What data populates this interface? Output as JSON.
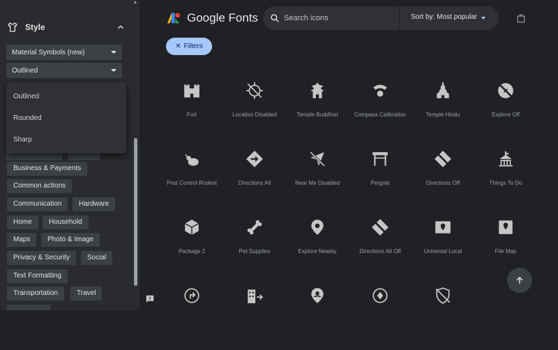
{
  "sidebar": {
    "style_label": "Style",
    "family_select": "Material Symbols (new)",
    "variant_select": "Outlined",
    "variant_options": [
      "Outlined",
      "Rounded",
      "Sharp"
    ],
    "categories": [
      "Business & Payments",
      "Common actions",
      "Communication",
      "Hardware",
      "Home",
      "Household",
      "Maps",
      "Photo & Image",
      "Privacy & Security",
      "Social",
      "Text Formatting",
      "Transportation",
      "Travel"
    ]
  },
  "header": {
    "logo_text": "Google Fonts",
    "search_placeholder": "Search icons",
    "sort_label": "Sort by: Most popular"
  },
  "filters_button": "Filters",
  "icons": [
    {
      "name": "Fort",
      "icon": "fort-icon"
    },
    {
      "name": "Location Disabled",
      "icon": "location-disabled-icon"
    },
    {
      "name": "Temple Buddhist",
      "icon": "temple-buddhist-icon"
    },
    {
      "name": "Compass Calibration",
      "icon": "compass-calibration-icon"
    },
    {
      "name": "Temple Hindu",
      "icon": "temple-hindu-icon"
    },
    {
      "name": "Explore Off",
      "icon": "explore-off-icon"
    },
    {
      "name": "Pest Control Rodent",
      "icon": "pest-control-rodent-icon"
    },
    {
      "name": "Directions Alt",
      "icon": "directions-alt-icon"
    },
    {
      "name": "Near Me Disabled",
      "icon": "near-me-disabled-icon"
    },
    {
      "name": "Pergola",
      "icon": "pergola-icon"
    },
    {
      "name": "Directions Off",
      "icon": "directions-off-icon"
    },
    {
      "name": "Things To Do",
      "icon": "things-to-do-icon"
    },
    {
      "name": "Package 2",
      "icon": "package-2-icon"
    },
    {
      "name": "Pet Supplies",
      "icon": "pet-supplies-icon"
    },
    {
      "name": "Explore Nearby",
      "icon": "explore-nearby-icon"
    },
    {
      "name": "Directions Alt Off",
      "icon": "directions-alt-off-icon"
    },
    {
      "name": "Universal Local",
      "icon": "universal-local-icon"
    },
    {
      "name": "File Map",
      "icon": "file-map-icon"
    },
    {
      "name": "",
      "icon": "turn-arrow-icon"
    },
    {
      "name": "",
      "icon": "domain-arrow-icon"
    },
    {
      "name": "",
      "icon": "person-pin-icon"
    },
    {
      "name": "",
      "icon": "location-arrow-icon"
    },
    {
      "name": "",
      "icon": "shield-off-icon"
    }
  ],
  "colors": {
    "background": "#202124",
    "sidebar": "#2a2b2e",
    "chip": "#3c4043",
    "accent": "#a8c7fa",
    "icon": "#c4c7c5"
  }
}
